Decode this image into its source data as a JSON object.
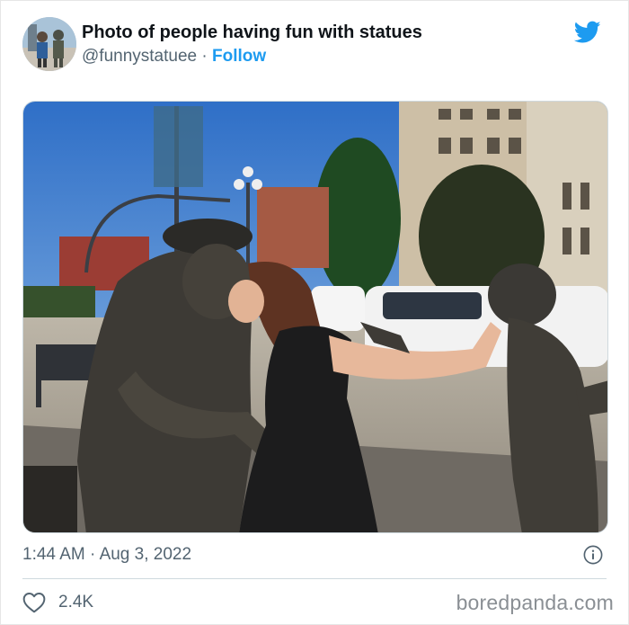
{
  "tweet": {
    "display_name": "Photo of people having fun with statues",
    "handle": "@funnystatuee",
    "separator": " · ",
    "follow_label": "Follow",
    "time": "1:44 AM",
    "date": "Aug 3, 2022",
    "like_count": "2.4K"
  },
  "icons": {
    "brand": "twitter-bird-icon",
    "info": "info-icon",
    "like": "heart-icon"
  },
  "photo": {
    "subject": "statue-kiss-photo"
  },
  "watermark": "boredpanda.com",
  "colors": {
    "accent": "#1d9bf0",
    "text_primary": "#0f1419",
    "text_secondary": "#536471",
    "border": "#cfd9de"
  }
}
